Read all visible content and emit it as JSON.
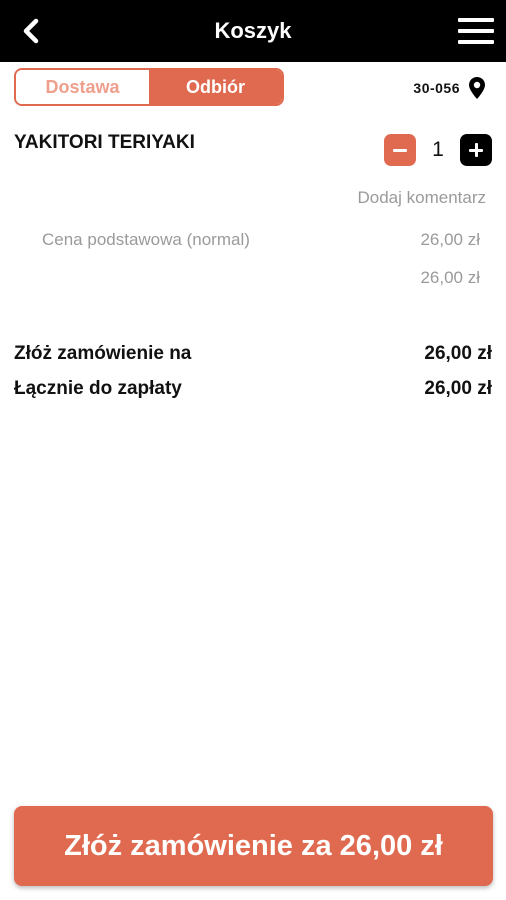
{
  "header": {
    "title": "Koszyk",
    "back_icon": "chevron-left-icon",
    "menu_icon": "hamburger-menu-icon"
  },
  "delivery_toggle": {
    "options": [
      {
        "label": "Dostawa",
        "selected": false
      },
      {
        "label": "Odbiór",
        "selected": true
      }
    ]
  },
  "location": {
    "postcode": "30-056",
    "icon": "map-pin-icon"
  },
  "cart": {
    "items": [
      {
        "name": "YAKITORI TERIYAKI",
        "quantity": "1",
        "comment_link": "Dodaj komentarz",
        "base_price_label": "Cena podstawowa (normal)",
        "base_price": "26,00 zł",
        "line_total": "26,00 zł"
      }
    ]
  },
  "summary": {
    "order_for_label": "Złóż zamówienie na",
    "order_for_value": "26,00 zł",
    "total_label": "Łącznie do zapłaty",
    "total_value": "26,00 zł"
  },
  "submit_button": {
    "label": "Złóż zamówienie za 26,00 zł"
  },
  "colors": {
    "accent": "#e06a4f",
    "accent_light": "#ef9f8c",
    "header_bg": "#000000",
    "muted_text": "#9a9a9a"
  }
}
